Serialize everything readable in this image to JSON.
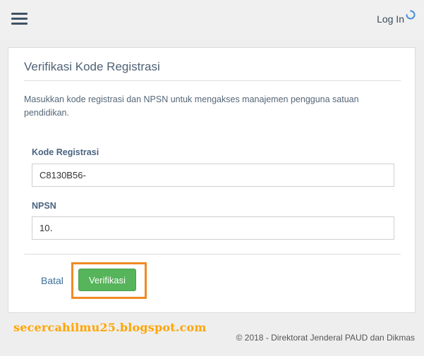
{
  "header": {
    "menu_icon": "hamburger-menu-icon",
    "login_label": "Log In",
    "login_icon": "loading-spinner-icon"
  },
  "panel": {
    "title": "Verifikasi Kode Registrasi",
    "instruction": "Masukkan kode registrasi dan NPSN untuk mengakses manajemen pengguna satuan pendidikan.",
    "fields": {
      "kode_registrasi": {
        "label": "Kode Registrasi",
        "value": "C8130B56-"
      },
      "npsn": {
        "label": "NPSN",
        "value": "10․"
      }
    },
    "buttons": {
      "cancel_label": "Batal",
      "verify_label": "Verifikasi"
    }
  },
  "watermark": "secercahilmu25.blogspot.com",
  "footer": {
    "text": "©  2018 - Direktorat Jenderal PAUD dan Dikmas"
  },
  "colors": {
    "primary_button": "#56b45a",
    "highlight_box": "#f08a24",
    "watermark": "#ffa500",
    "link": "#3d6f9a",
    "title": "#4f6275"
  }
}
